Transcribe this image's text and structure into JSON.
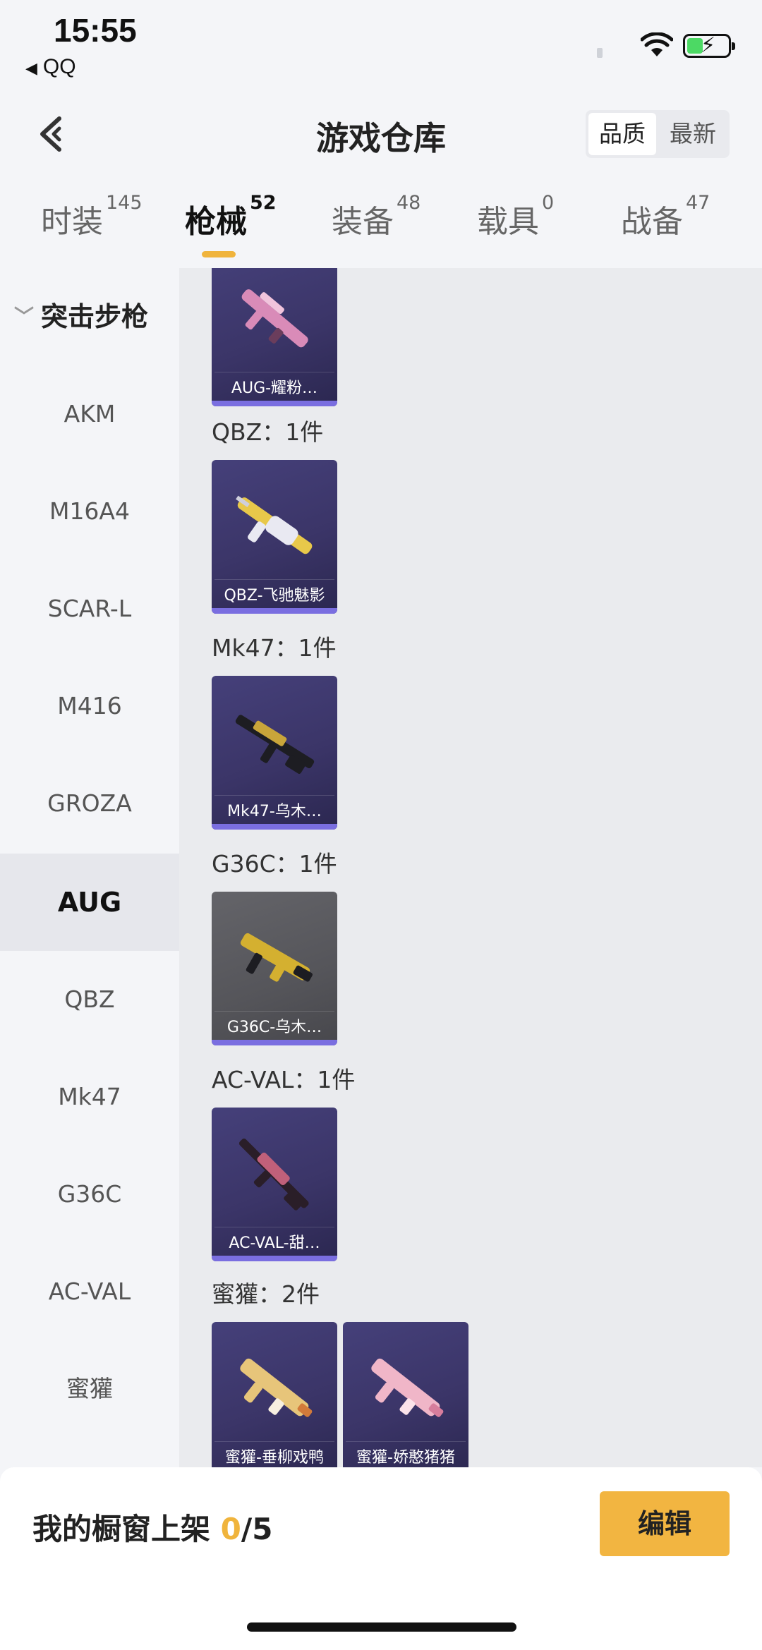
{
  "status_bar": {
    "time": "15:55",
    "back_app": "QQ"
  },
  "header": {
    "title": "游戏仓库",
    "sort_options": [
      "品质",
      "最新"
    ],
    "sort_active": "品质"
  },
  "tabs": [
    {
      "label": "时装",
      "count": "145"
    },
    {
      "label": "枪械",
      "count": "52"
    },
    {
      "label": "装备",
      "count": "48"
    },
    {
      "label": "载具",
      "count": "0"
    },
    {
      "label": "战备",
      "count": "47"
    }
  ],
  "sidebar": {
    "group": "突击步枪",
    "items": [
      "AKM",
      "M16A4",
      "SCAR-L",
      "M416",
      "GROZA",
      "AUG",
      "QBZ",
      "Mk47",
      "G36C",
      "AC-VAL",
      "蜜獾"
    ],
    "active": "AUG"
  },
  "content": {
    "sections": [
      {
        "label": "QBZ：1件"
      },
      {
        "label": "Mk47：1件"
      },
      {
        "label": "G36C：1件"
      },
      {
        "label": "AC-VAL：1件"
      },
      {
        "label": "蜜獾：2件"
      }
    ],
    "cards": [
      {
        "name": "AUG-耀粉…",
        "gun_color": "#d98bb8"
      },
      {
        "name": "QBZ-飞驰魅影",
        "gun_color": "#e8c84a"
      },
      {
        "name": "Mk47-乌木…",
        "gun_color": "#c9a53a"
      },
      {
        "name": "G36C-乌木…",
        "gun_color": "#d4b030"
      },
      {
        "name": "AC-VAL-甜…",
        "gun_color": "#c0607a"
      },
      {
        "name": "蜜獾-垂柳戏鸭",
        "gun_color": "#e7c57a"
      },
      {
        "name": "蜜獾-娇憨猪猪",
        "gun_color": "#f0b6c8"
      }
    ]
  },
  "bottom_bar": {
    "showcase_label": "我的橱窗上架",
    "showcase_count": "0",
    "showcase_total": "/5",
    "edit_label": "编辑"
  },
  "colors": {
    "accent": "#f0b43c",
    "card_purple": "#3b3568",
    "card_gray": "#55555a"
  }
}
